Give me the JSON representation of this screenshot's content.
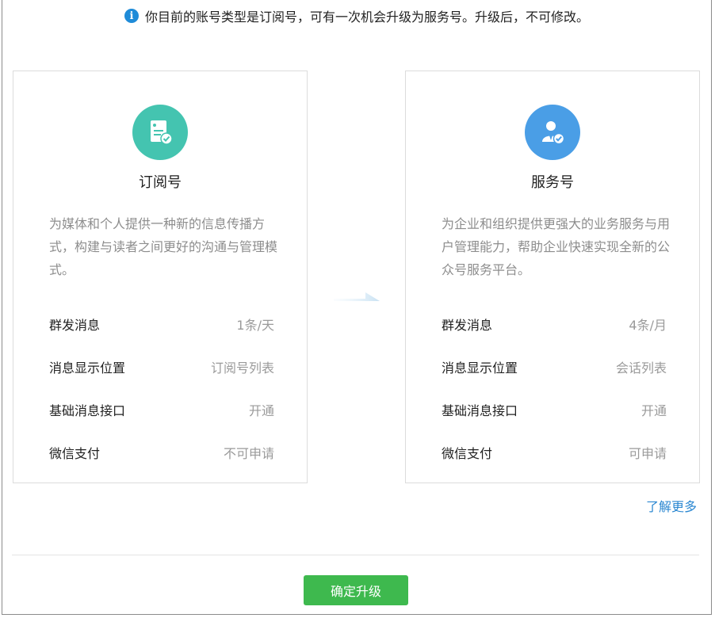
{
  "notice": {
    "text": "你目前的账号类型是订阅号，可有一次机会升级为服务号。升级后，不可修改。"
  },
  "cards": [
    {
      "title": "订阅号",
      "icon": "document-check-icon",
      "color": "#44c4b0",
      "description": "为媒体和个人提供一种新的信息传播方式，构建与读者之间更好的沟通与管理模式。",
      "features": [
        {
          "label": "群发消息",
          "value": "1条/天"
        },
        {
          "label": "消息显示位置",
          "value": "订阅号列表"
        },
        {
          "label": "基础消息接口",
          "value": "开通"
        },
        {
          "label": "微信支付",
          "value": "不可申请"
        }
      ]
    },
    {
      "title": "服务号",
      "icon": "user-check-icon",
      "color": "#4a9ee6",
      "description": "为企业和组织提供更强大的业务服务与用户管理能力，帮助企业快速实现全新的公众号服务平台。",
      "features": [
        {
          "label": "群发消息",
          "value": "4条/月"
        },
        {
          "label": "消息显示位置",
          "value": "会话列表"
        },
        {
          "label": "基础消息接口",
          "value": "开通"
        },
        {
          "label": "微信支付",
          "value": "可申请"
        }
      ]
    }
  ],
  "learn_more": "了解更多",
  "confirm_button": "确定升级"
}
